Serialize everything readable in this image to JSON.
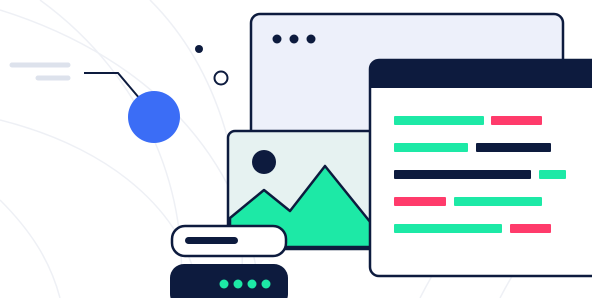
{
  "illustration": {
    "subject": "code-editor-and-image-hero-illustration",
    "colors": {
      "navy": "#0d1b3e",
      "window_fill": "#edf0fa",
      "image_fill": "#e6f2f1",
      "mountain": "#1de9a6",
      "green_line": "#1de9a6",
      "pink_line": "#ff3b6b",
      "blue_dot": "#3b6df6",
      "arc": "#eef0f5",
      "speed_lines": "#dde2ec",
      "white": "#ffffff"
    },
    "icons": [
      "browser-window-icon",
      "image-window-icon",
      "code-window-icon",
      "server-rack-icon",
      "mountain-icon",
      "sun-icon"
    ]
  }
}
